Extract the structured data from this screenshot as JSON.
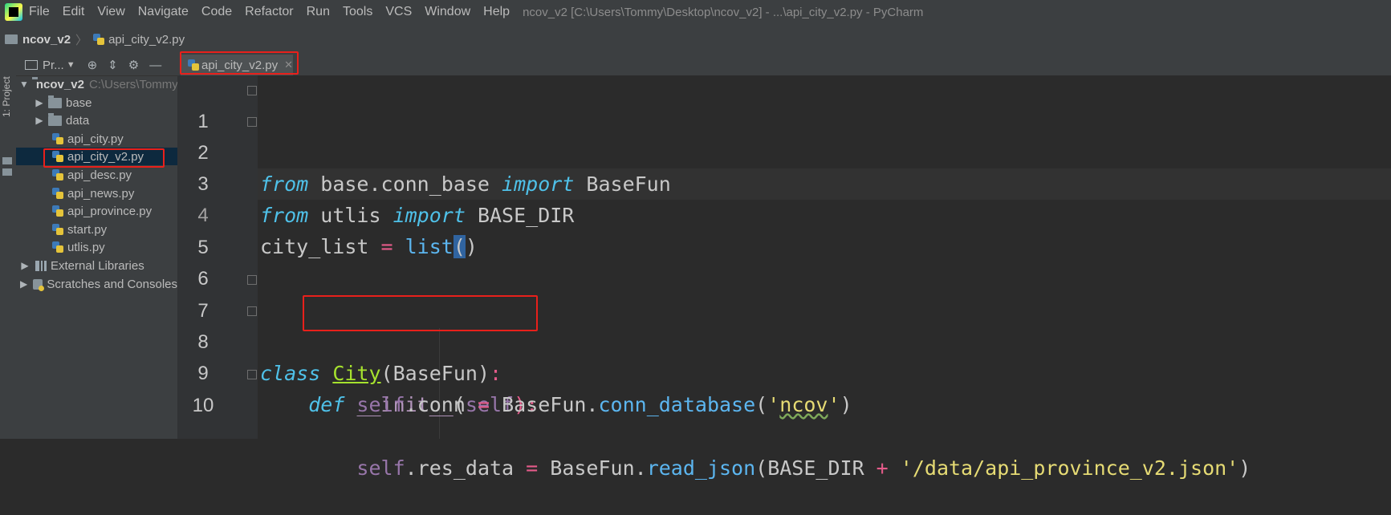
{
  "menubar": {
    "items": [
      "File",
      "Edit",
      "View",
      "Navigate",
      "Code",
      "Refactor",
      "Run",
      "Tools",
      "VCS",
      "Window",
      "Help"
    ],
    "title": "ncov_v2 [C:\\Users\\Tommy\\Desktop\\ncov_v2] - ...\\api_city_v2.py - PyCharm"
  },
  "breadcrumb": {
    "project": "ncov_v2",
    "file": "api_city_v2.py"
  },
  "sidebar": {
    "tool_window_label": "1: Project"
  },
  "project_panel": {
    "view_label": "Pr...",
    "root": {
      "name": "ncov_v2",
      "path": "C:\\Users\\Tommy"
    },
    "folders": [
      "base",
      "data"
    ],
    "files": [
      "api_city.py",
      "api_city_v2.py",
      "api_desc.py",
      "api_news.py",
      "api_province.py",
      "start.py",
      "utlis.py"
    ],
    "selected_file": "api_city_v2.py",
    "external_libraries": "External Libraries",
    "scratches": "Scratches and Consoles"
  },
  "editor": {
    "tab_label": "api_city_v2.py",
    "line_numbers": [
      "1",
      "2",
      "3",
      "4",
      "5",
      "6",
      "7",
      "8",
      "9",
      "10"
    ],
    "line1": {
      "kw1": "from",
      "mod": " base.conn_base ",
      "kw2": "import",
      "name": " BaseFun"
    },
    "line2": {
      "kw1": "from",
      "mod": " utlis ",
      "kw2": "import",
      "name": " BASE_DIR"
    },
    "line4": {
      "var": "city_list",
      "eq": " = ",
      "fn": "list",
      "open": "(",
      "close": ")"
    },
    "line7": {
      "kw": "class",
      "name": "City",
      "args": "(BaseFun)",
      "colon": ":"
    },
    "line8": {
      "indent": "    ",
      "kw": "def",
      "name": "__init__",
      "open": "(",
      "self": "self",
      "close": "):"
    },
    "line9": {
      "indent": "        ",
      "self": "self",
      "attr": ".conn ",
      "eq": "=",
      "cls": " BaseFun.",
      "fn": "conn_database",
      "open": "(",
      "q1": "'",
      "str": "ncov",
      "q2": "'",
      "close": ")"
    },
    "line10": {
      "indent": "        ",
      "self": "self",
      "attr": ".res_data ",
      "eq": "=",
      "cls": " BaseFun.",
      "fn": "read_json",
      "args": "(BASE_DIR ",
      "plus": "+",
      "str": " '/data/api_province_v2.json'",
      "close": ")"
    }
  },
  "colors": {
    "annotation_box": "#e8201b",
    "keyword": "#4fc1e9",
    "operator": "#e55b8a",
    "string": "#e6db74"
  }
}
